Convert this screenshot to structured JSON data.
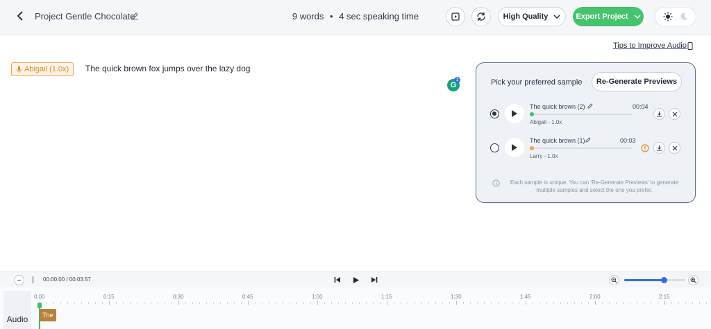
{
  "header": {
    "project_title": "Project Gentle Chocolate",
    "word_count": "9 words",
    "separator": "•",
    "speaking_time": "4 sec speaking time",
    "quality_label": "High Quality",
    "export_label": "Export Project",
    "icons": [
      "back-arrow-icon",
      "edit-icon",
      "preview-icon",
      "refresh-icon",
      "chevron-down-icon",
      "sun-icon",
      "moon-icon"
    ]
  },
  "editor": {
    "tips_link": "Tips to Improve Audio",
    "voice_tag": "Abigail (1.0x)",
    "text": "The quick brown fox jumps over the lazy dog",
    "grammarly_letter": "G",
    "grammarly_count": "1"
  },
  "preview_panel": {
    "title": "Pick your preferred sample",
    "regenerate_label": "Re-Generate Previews",
    "samples": [
      {
        "name": "The quick brown (2)",
        "time": "00:04",
        "voice": "Abigail - 1.0x",
        "selected": true,
        "dot_color": "#3dc26a",
        "warning": false
      },
      {
        "name": "The quick brown (1)",
        "time": "00:03",
        "voice": "Larry - 1.0x",
        "selected": false,
        "dot_color": "#f0a54a",
        "warning": true
      }
    ],
    "note": "Each sample is unique. You can 'Re-Generate Previews' to generate multiple samples and select the one you prefer."
  },
  "player": {
    "minus": "−",
    "current_time": "00:00.00",
    "time_sep": "/",
    "total_time": "00:03.57",
    "zoom_level": 0.65
  },
  "timeline": {
    "track_label": "Audio",
    "ticks": [
      "0:00",
      "0:15",
      "0:30",
      "0:45",
      "1:00",
      "1:15",
      "1:30",
      "1:45",
      "2:00",
      "2:15"
    ],
    "clip_label": "The"
  },
  "colors": {
    "accent_green": "#45c46b",
    "accent_blue": "#2f6fe4",
    "voice_orange": "#e08a22"
  }
}
